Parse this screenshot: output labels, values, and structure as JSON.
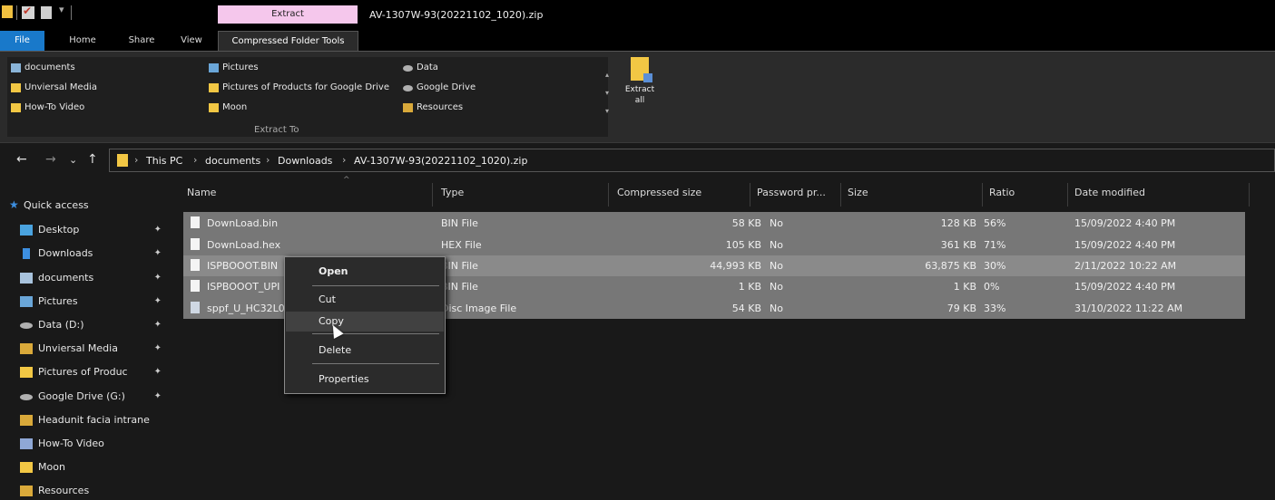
{
  "window": {
    "title": "AV-1307W-93(20221102_1020).zip",
    "context_tab_header": "Extract"
  },
  "tabs": {
    "file": "File",
    "home": "Home",
    "share": "Share",
    "view": "View",
    "compressed": "Compressed Folder Tools"
  },
  "ribbon": {
    "destinations": {
      "col1": [
        "documents",
        "Unviersal Media",
        "How-To Video"
      ],
      "col2": [
        "Pictures",
        "Pictures of Products for Google Drive",
        "Moon"
      ],
      "col3": [
        "Data",
        "Google Drive",
        "Resources"
      ]
    },
    "group_label": "Extract To",
    "extract_all": "Extract all"
  },
  "address": {
    "crumbs": [
      "This PC",
      "documents",
      "Downloads",
      "AV-1307W-93(20221102_1020).zip"
    ]
  },
  "sidebar": {
    "quick_access": "Quick access",
    "items": [
      {
        "label": "Desktop",
        "icon": "desktop-icon",
        "pinned": true
      },
      {
        "label": "Downloads",
        "icon": "downloads-icon",
        "pinned": true
      },
      {
        "label": "documents",
        "icon": "documents-icon",
        "pinned": true
      },
      {
        "label": "Pictures",
        "icon": "pictures-icon",
        "pinned": true
      },
      {
        "label": "Data (D:)",
        "icon": "drive-icon",
        "pinned": true
      },
      {
        "label": "Unviersal Media",
        "icon": "user-folder-icon",
        "pinned": true
      },
      {
        "label": "Pictures of Produc",
        "icon": "folder-icon",
        "pinned": true
      },
      {
        "label": "Google Drive (G:)",
        "icon": "drive-icon",
        "pinned": true
      },
      {
        "label": "Headunit facia intrane",
        "icon": "user-folder-icon",
        "pinned": false
      },
      {
        "label": "How-To Video",
        "icon": "user-folder-icon",
        "pinned": false
      },
      {
        "label": "Moon",
        "icon": "folder-icon",
        "pinned": false
      },
      {
        "label": "Resources",
        "icon": "user-folder-icon",
        "pinned": false
      }
    ]
  },
  "columns": {
    "name": "Name",
    "type": "Type",
    "compressed": "Compressed size",
    "password": "Password pr...",
    "size": "Size",
    "ratio": "Ratio",
    "date": "Date modified"
  },
  "files": [
    {
      "name": "DownLoad.bin",
      "type": "BIN File",
      "compressed": "58 KB",
      "password": "No",
      "size": "128 KB",
      "ratio": "56%",
      "date": "15/09/2022 4:40 PM"
    },
    {
      "name": "DownLoad.hex",
      "type": "HEX File",
      "compressed": "105 KB",
      "password": "No",
      "size": "361 KB",
      "ratio": "71%",
      "date": "15/09/2022 4:40 PM"
    },
    {
      "name": "ISPBOOOT.BIN",
      "type": "BIN File",
      "compressed": "44,993 KB",
      "password": "No",
      "size": "63,875 KB",
      "ratio": "30%",
      "date": "2/11/2022 10:22 AM"
    },
    {
      "name": "ISPBOOOT_UPI",
      "type": "BIN File",
      "compressed": "1 KB",
      "password": "No",
      "size": "1 KB",
      "ratio": "0%",
      "date": "15/09/2022 4:40 PM"
    },
    {
      "name": "sppf_U_HC32L0",
      "type": "Disc Image File",
      "compressed": "54 KB",
      "password": "No",
      "size": "79 KB",
      "ratio": "33%",
      "date": "31/10/2022 11:22 AM"
    }
  ],
  "context_menu": {
    "open": "Open",
    "cut": "Cut",
    "copy": "Copy",
    "delete": "Delete",
    "properties": "Properties"
  },
  "colors": {
    "file_tab": "#1979ca",
    "extract_header": "#f5c7ec",
    "selection": "#777777",
    "background": "#191919"
  }
}
